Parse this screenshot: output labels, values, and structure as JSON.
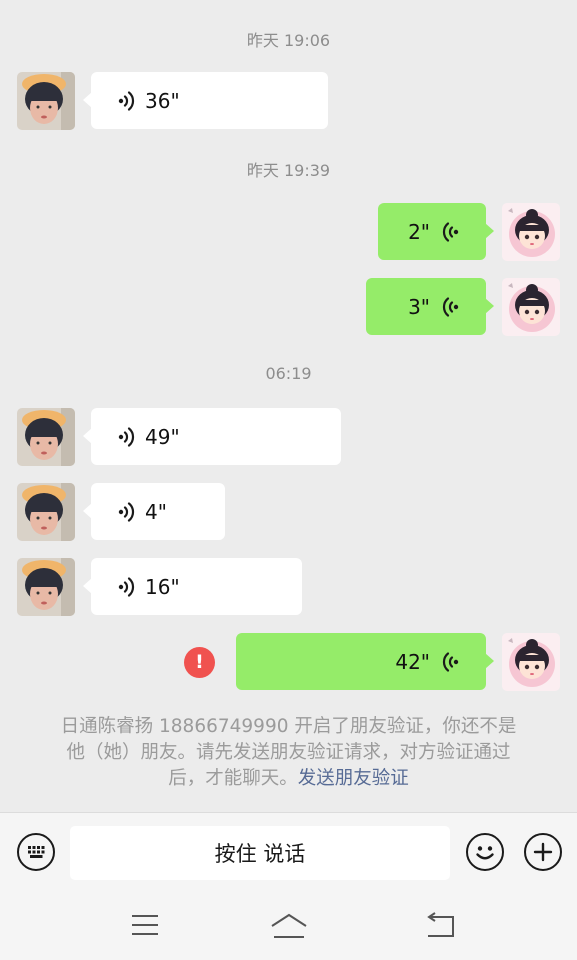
{
  "messages": [
    {
      "kind": "time",
      "text": "昨天 19:06"
    },
    {
      "kind": "voice",
      "direction": "in",
      "duration": "36\""
    },
    {
      "kind": "time",
      "text": "昨天 19:39"
    },
    {
      "kind": "voice",
      "direction": "out",
      "duration": "2\""
    },
    {
      "kind": "voice",
      "direction": "out",
      "duration": "3\""
    },
    {
      "kind": "time",
      "text": "06:19"
    },
    {
      "kind": "voice",
      "direction": "in",
      "duration": "49\""
    },
    {
      "kind": "voice",
      "direction": "in",
      "duration": "4\""
    },
    {
      "kind": "voice",
      "direction": "in",
      "duration": "16\""
    },
    {
      "kind": "voice",
      "direction": "out",
      "duration": "42\"",
      "status": "failed",
      "status_icon": "!"
    }
  ],
  "notice": {
    "text_line1": "日通陈睿扬 18866749990 开启了朋友验证，你还不是",
    "text_line2": "他（她）朋友。请先发送朋友验证请求，对方验证通过",
    "text_line3": "后，才能聊天。",
    "link": "发送朋友验证"
  },
  "input_bar": {
    "hold_to_talk_label": "按住 说话",
    "left_icon": "keyboard-icon",
    "right_icons": [
      "emoji-icon",
      "plus-icon"
    ]
  },
  "navigation": {
    "icons": [
      "menu-icon",
      "home-icon",
      "back-icon"
    ]
  },
  "colors": {
    "background": "#ececec",
    "incoming_bubble": "#ffffff",
    "outgoing_bubble": "#95ec69",
    "error": "#f0524f",
    "link": "#576b95"
  }
}
